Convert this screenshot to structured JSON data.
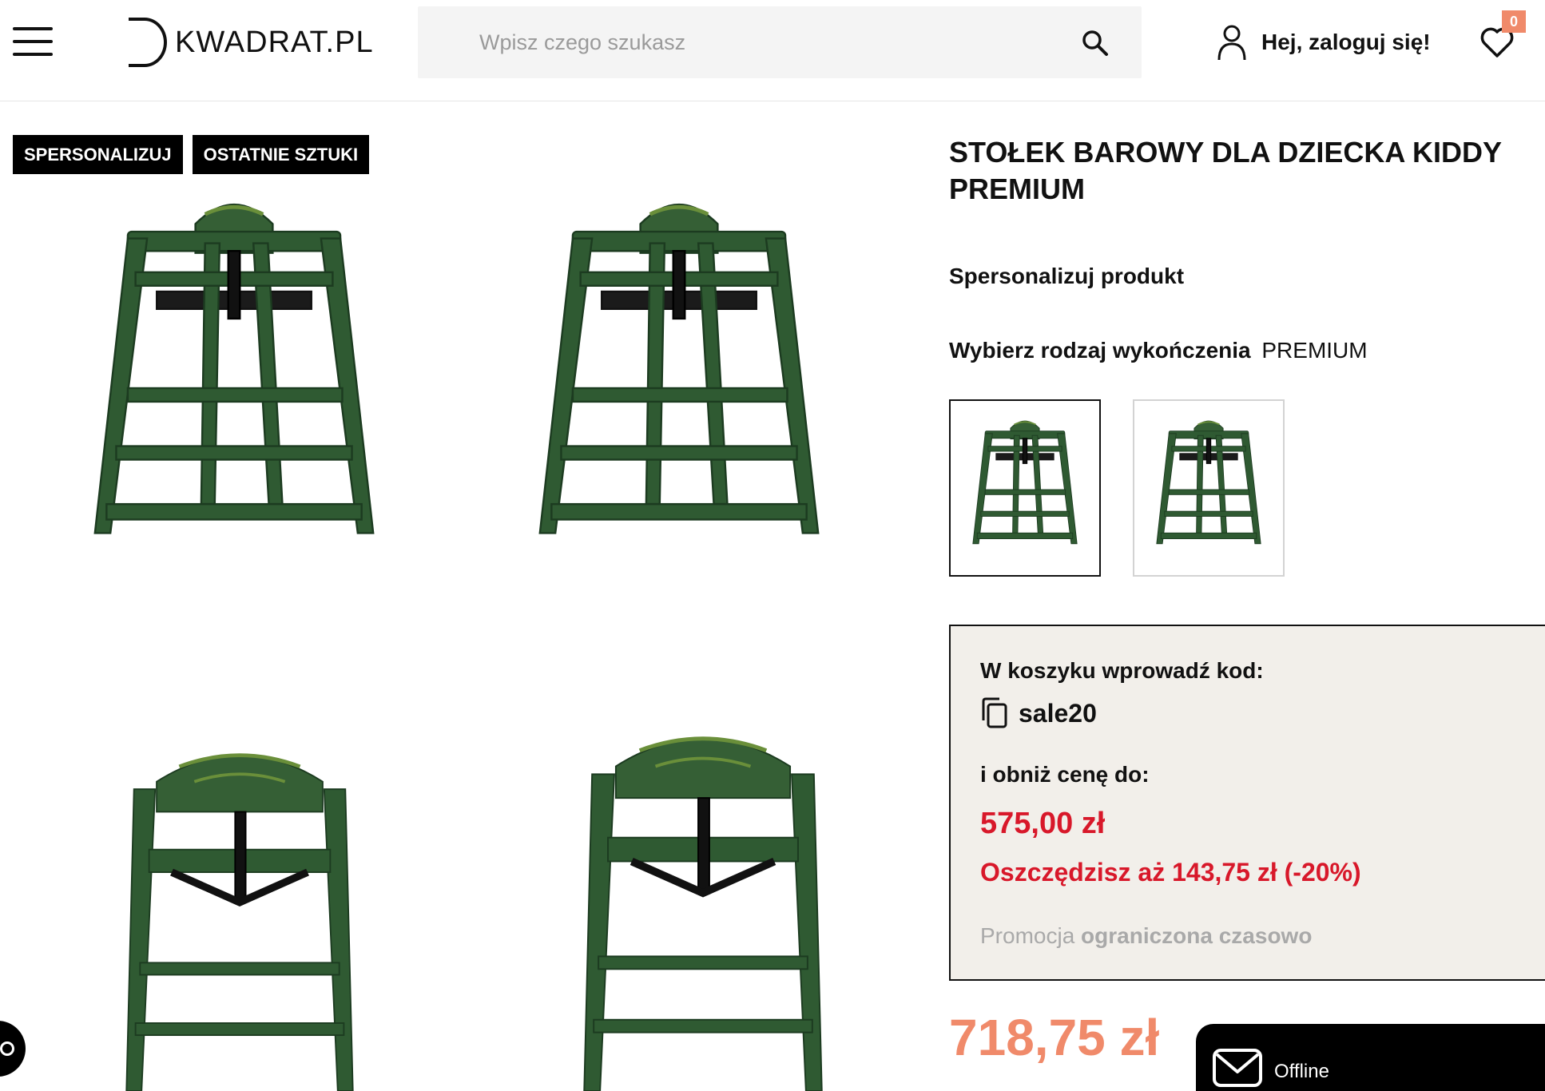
{
  "header": {
    "logo_text": "KWADRAT.PL",
    "search_placeholder": "Wpisz czego szukasz",
    "account_label": "Hej, zaloguj się!",
    "wishlist_count": "0"
  },
  "product": {
    "badges": [
      "SPERSONALIZUJ",
      "OSTATNIE SZTUKI"
    ],
    "title": "STOŁEK BAROWY DLA DZIECKA KIDDY PREMIUM",
    "personalize_label": "Spersonalizuj produkt",
    "finish_label": "Wybierz rodzaj wykończenia",
    "finish_value": "PREMIUM",
    "price": "718,75 zł"
  },
  "promo": {
    "line1": "W koszyku wprowadź kod:",
    "code": "sale20",
    "line2": "i obniż cenę do:",
    "discounted_price": "575,00 zł",
    "savings": "Oszczędzisz aż 143,75 zł (-20%)",
    "note_prefix": "Promocja",
    "note_bold": "ograniczona czasowo"
  },
  "chat": {
    "status": "Offline"
  },
  "colors": {
    "accent_price": "#f08a6a",
    "promo_red": "#d8182a",
    "promo_bg": "#f2efea",
    "chair_green": "#2f5a32"
  }
}
